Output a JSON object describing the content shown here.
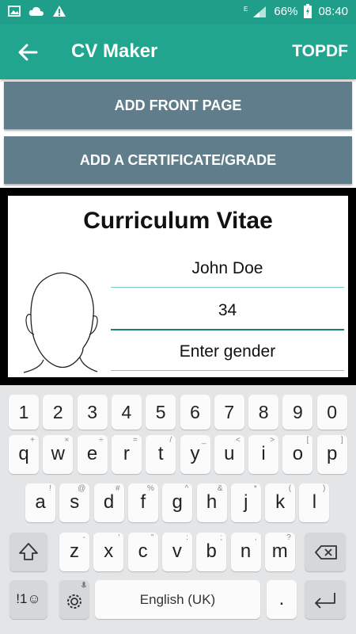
{
  "status_bar": {
    "battery": "66%",
    "time": "08:40",
    "signal_label": "E"
  },
  "app_bar": {
    "title": "CV Maker",
    "action": "TOPDF"
  },
  "buttons": {
    "front_page": "ADD FRONT PAGE",
    "certificate": "ADD A CERTIFICATE/GRADE"
  },
  "cv": {
    "title": "Curriculum Vitae",
    "name_value": "John Doe",
    "age_value": "34",
    "gender_placeholder": "Enter gender"
  },
  "keyboard": {
    "digits": [
      "1",
      "2",
      "3",
      "4",
      "5",
      "6",
      "7",
      "8",
      "9",
      "0"
    ],
    "row1": [
      {
        "key": "q",
        "sup": "+"
      },
      {
        "key": "w",
        "sup": "×"
      },
      {
        "key": "e",
        "sup": "÷"
      },
      {
        "key": "r",
        "sup": "="
      },
      {
        "key": "t",
        "sup": "/"
      },
      {
        "key": "y",
        "sup": "_"
      },
      {
        "key": "u",
        "sup": "<"
      },
      {
        "key": "i",
        "sup": ">"
      },
      {
        "key": "o",
        "sup": "["
      },
      {
        "key": "p",
        "sup": "]"
      }
    ],
    "row2": [
      {
        "key": "a",
        "sup": "!"
      },
      {
        "key": "s",
        "sup": "@"
      },
      {
        "key": "d",
        "sup": "#"
      },
      {
        "key": "f",
        "sup": "%"
      },
      {
        "key": "g",
        "sup": "^"
      },
      {
        "key": "h",
        "sup": "&"
      },
      {
        "key": "j",
        "sup": "*"
      },
      {
        "key": "k",
        "sup": "("
      },
      {
        "key": "l",
        "sup": ")"
      }
    ],
    "row3": [
      {
        "key": "z",
        "sup": "-"
      },
      {
        "key": "x",
        "sup": "'"
      },
      {
        "key": "c",
        "sup": "\""
      },
      {
        "key": "v",
        "sup": ":"
      },
      {
        "key": "b",
        "sup": ";"
      },
      {
        "key": "n",
        "sup": ","
      },
      {
        "key": "m",
        "sup": "?"
      }
    ],
    "symbols_key": "!1☺",
    "space_label": "English (UK)",
    "period_key": "."
  },
  "colors": {
    "status_bar": "#1f9e8a",
    "app_bar": "#22a58e",
    "button": "#5f7d8b",
    "field_line": "#7fcdc0"
  }
}
